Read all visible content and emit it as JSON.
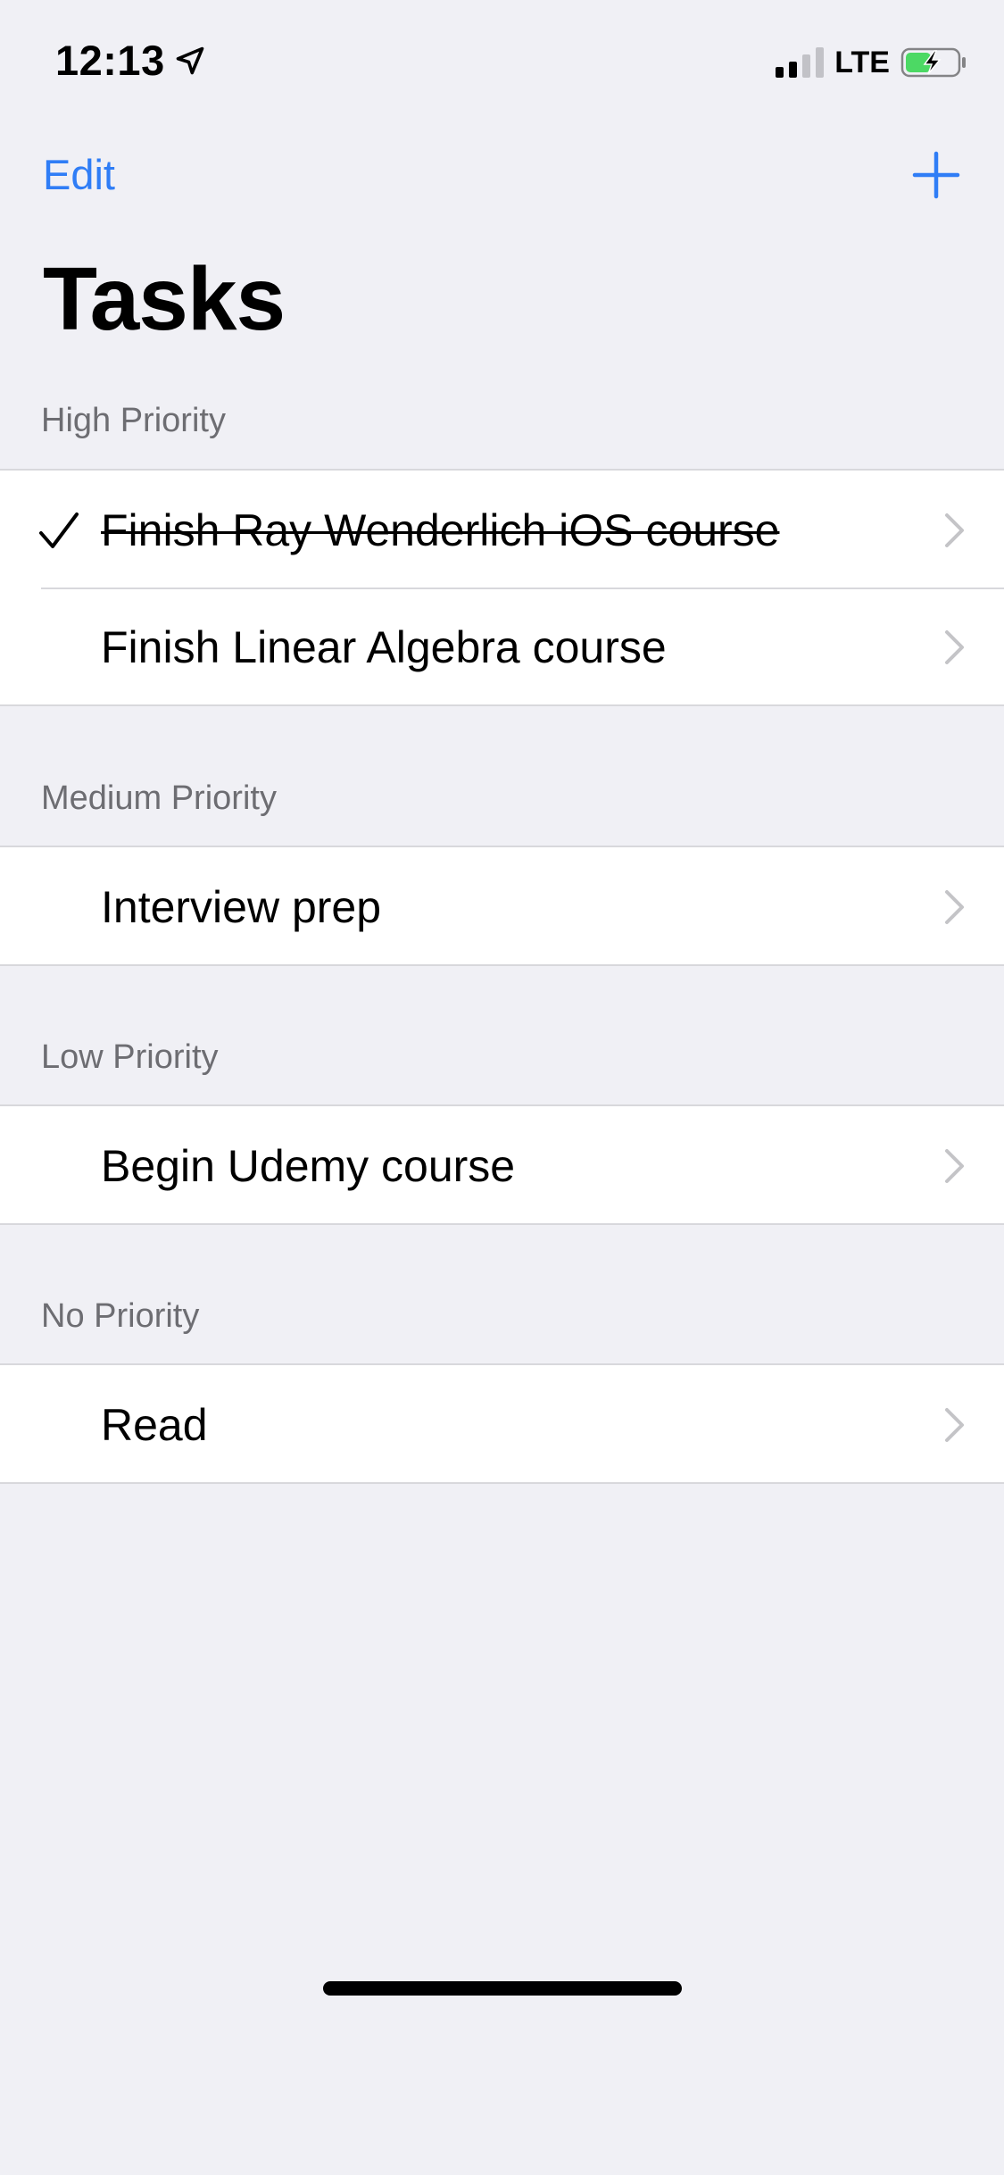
{
  "status_bar": {
    "time": "12:13",
    "network": "LTE",
    "signal_bars_active": 2,
    "signal_bars_total": 4,
    "battery_level": 0.5,
    "battery_charging": true,
    "location_active": true
  },
  "nav": {
    "edit_label": "Edit",
    "add_icon": "plus-icon",
    "title": "Tasks"
  },
  "colors": {
    "accent": "#2f7df6",
    "background": "#f0f0f5",
    "header_text": "#6d6d72",
    "separator": "#d8d8dc",
    "chevron": "#c4c4c7",
    "battery_green": "#4cd964"
  },
  "sections": [
    {
      "header": "High Priority",
      "items": [
        {
          "label": "Finish Ray Wenderlich iOS course",
          "completed": true
        },
        {
          "label": "Finish Linear Algebra course",
          "completed": false
        }
      ]
    },
    {
      "header": "Medium Priority",
      "items": [
        {
          "label": "Interview prep",
          "completed": false
        }
      ]
    },
    {
      "header": "Low Priority",
      "items": [
        {
          "label": "Begin Udemy course",
          "completed": false
        }
      ]
    },
    {
      "header": "No Priority",
      "items": [
        {
          "label": "Read",
          "completed": false
        }
      ]
    }
  ]
}
